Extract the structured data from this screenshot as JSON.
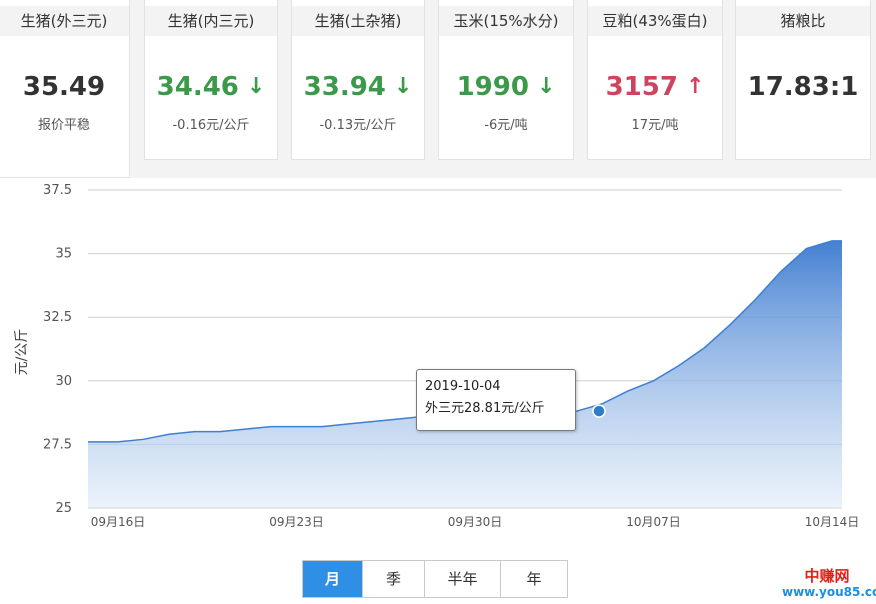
{
  "cards": [
    {
      "title": "生猪(外三元)",
      "value": "35.49",
      "arrow": "",
      "sub": "报价平稳",
      "color": "#333333"
    },
    {
      "title": "生猪(内三元)",
      "value": "34.46",
      "arrow": "↓",
      "sub": "-0.16元/公斤",
      "color": "#3a9a4a"
    },
    {
      "title": "生猪(土杂猪)",
      "value": "33.94",
      "arrow": "↓",
      "sub": "-0.13元/公斤",
      "color": "#3a9a4a"
    },
    {
      "title": "玉米(15%水分)",
      "value": "1990",
      "arrow": "↓",
      "sub": "-6元/吨",
      "color": "#3a9a4a"
    },
    {
      "title": "豆粕(43%蛋白)",
      "value": "3157",
      "arrow": "↑",
      "sub": "17元/吨",
      "color": "#d0435e"
    },
    {
      "title": "猪粮比",
      "value": "17.83:1",
      "arrow": "",
      "sub": "",
      "color": "#333333"
    }
  ],
  "chart_data": {
    "type": "area",
    "ylabel": "元/公斤",
    "ylim": [
      25,
      37.5
    ],
    "yticks": [
      25,
      27.5,
      30,
      32.5,
      35,
      37.5
    ],
    "ytick_labels": [
      "25",
      "27.5",
      "30",
      "32.5",
      "35",
      "37.5"
    ],
    "xtick_labels": [
      "09月16日",
      "09月23日",
      "09月30日",
      "10月07日",
      "10月14日"
    ],
    "xtick_dates": [
      "2019-09-16",
      "2019-09-23",
      "2019-09-30",
      "2019-10-07",
      "2019-10-14"
    ],
    "grid": true,
    "series": [
      {
        "color": "#3f7fd2",
        "x": [
          "2019-09-16",
          "2019-09-17",
          "2019-09-18",
          "2019-09-19",
          "2019-09-20",
          "2019-09-21",
          "2019-09-22",
          "2019-09-23",
          "2019-09-24",
          "2019-09-25",
          "2019-09-26",
          "2019-09-27",
          "2019-09-28",
          "2019-09-29",
          "2019-09-30",
          "2019-10-01",
          "2019-10-02",
          "2019-10-03",
          "2019-10-04",
          "2019-10-05",
          "2019-10-06",
          "2019-10-07",
          "2019-10-08",
          "2019-10-09",
          "2019-10-10",
          "2019-10-11",
          "2019-10-12",
          "2019-10-13",
          "2019-10-14"
        ],
        "values": [
          27.6,
          27.7,
          27.9,
          28.0,
          28.0,
          28.1,
          28.2,
          28.2,
          28.2,
          28.3,
          28.4,
          28.5,
          28.6,
          28.6,
          28.7,
          28.7,
          28.7,
          28.7,
          28.81,
          29.1,
          29.6,
          30.0,
          30.6,
          31.3,
          32.2,
          33.2,
          34.3,
          35.2,
          35.5
        ]
      }
    ],
    "highlight": {
      "date": "2019-10-04",
      "value": 28.81
    }
  },
  "tooltip": {
    "date": "2019-10-04",
    "line": "外三元28.81元/公斤"
  },
  "range_buttons": [
    {
      "label": "月",
      "active": true
    },
    {
      "label": "季",
      "active": false
    },
    {
      "label": "半年",
      "active": false
    },
    {
      "label": "年",
      "active": false
    }
  ],
  "watermark": {
    "line1": "中赚网",
    "line2": "www.you85.com"
  }
}
